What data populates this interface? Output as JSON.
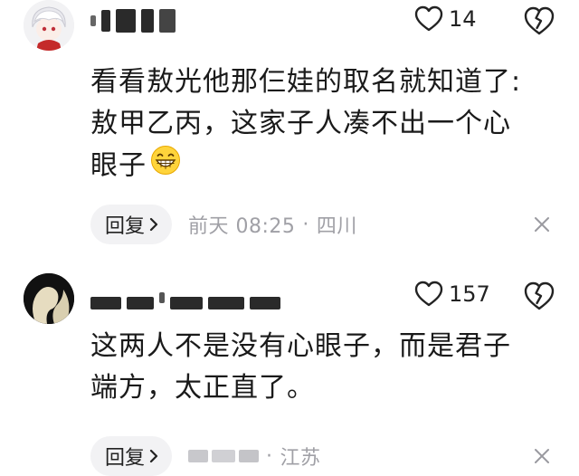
{
  "comments": [
    {
      "like_count": "14",
      "content_lines": [
        "看看敖光他那仨娃的取名就知道了:",
        "敖甲乙丙，这家子人凑不出一个心",
        "眼子"
      ],
      "emoji": "grinning-face-emoji",
      "reply_label": "回复",
      "time": "前天 08:25",
      "separator": "·",
      "location": "四川"
    },
    {
      "like_count": "157",
      "content_lines": [
        "这两人不是没有心眼子，而是君子",
        "端方，太正直了。"
      ],
      "reply_label": "回复",
      "separator": "·",
      "location": "江苏"
    }
  ],
  "icons": {
    "like": "heart-outline-icon",
    "dislike": "broken-heart-icon",
    "close": "close-icon",
    "chevron": "chevron-right-icon"
  },
  "colors": {
    "text": "#1a1a1a",
    "meta": "#a0a0a6",
    "reply_bg": "#f2f2f4",
    "icon": "#222222"
  }
}
